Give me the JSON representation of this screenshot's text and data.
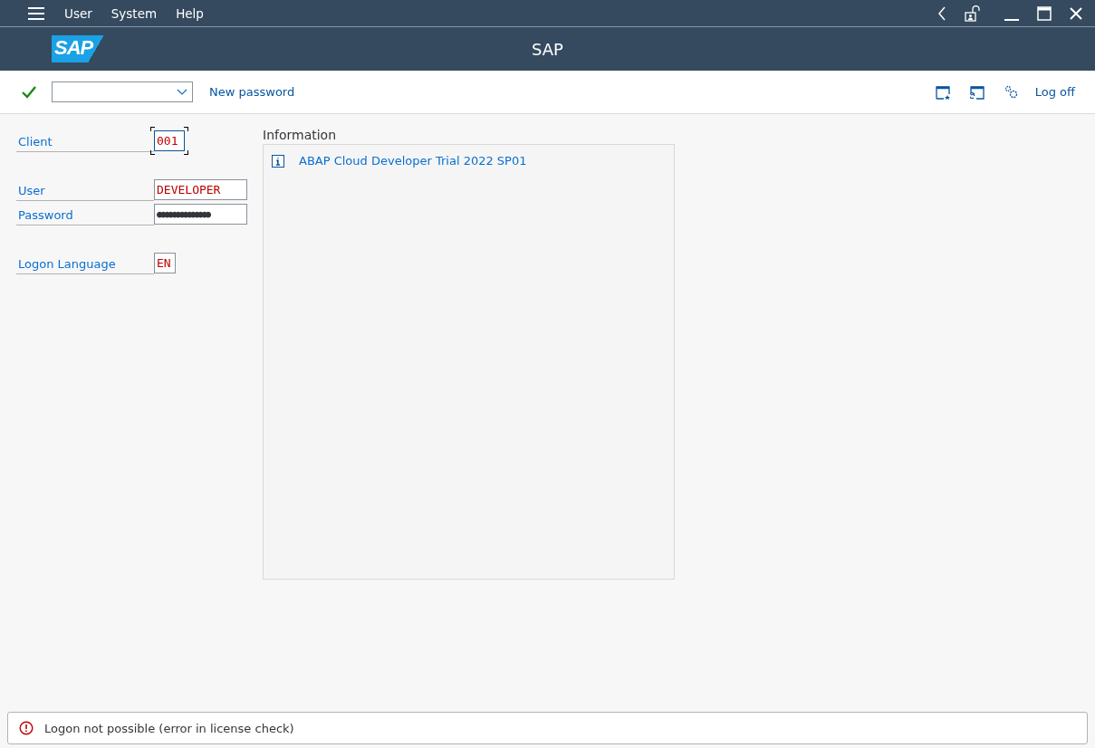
{
  "menu": [
    {
      "label": "User"
    },
    {
      "label": "System"
    },
    {
      "label": "Help"
    }
  ],
  "header": {
    "logo": "SAP",
    "title": "SAP"
  },
  "toolbar": {
    "left_actions": [
      {
        "label": "New password"
      }
    ],
    "right_actions": [
      {
        "label": "Log off"
      }
    ]
  },
  "form": [
    {
      "fields": [
        {
          "kind": "text",
          "label": "Client",
          "value": "001",
          "focused": true
        }
      ]
    },
    {
      "fields": [
        {
          "kind": "text",
          "label": "User",
          "value": "DEVELOPER",
          "focused": false
        },
        {
          "kind": "password",
          "label": "Password",
          "value": "●●●●●●●●●●●●●●",
          "focused": false
        }
      ]
    },
    {
      "fields": [
        {
          "kind": "text",
          "label": "Logon Language",
          "value": "EN",
          "focused": false
        }
      ]
    }
  ],
  "information": {
    "title": "Information",
    "items": [
      {
        "text": "ABAP Cloud Developer Trial 2022 SP01"
      }
    ]
  },
  "status_bar": {
    "kind": "error",
    "message": "Logon not possible (error in license check)"
  }
}
